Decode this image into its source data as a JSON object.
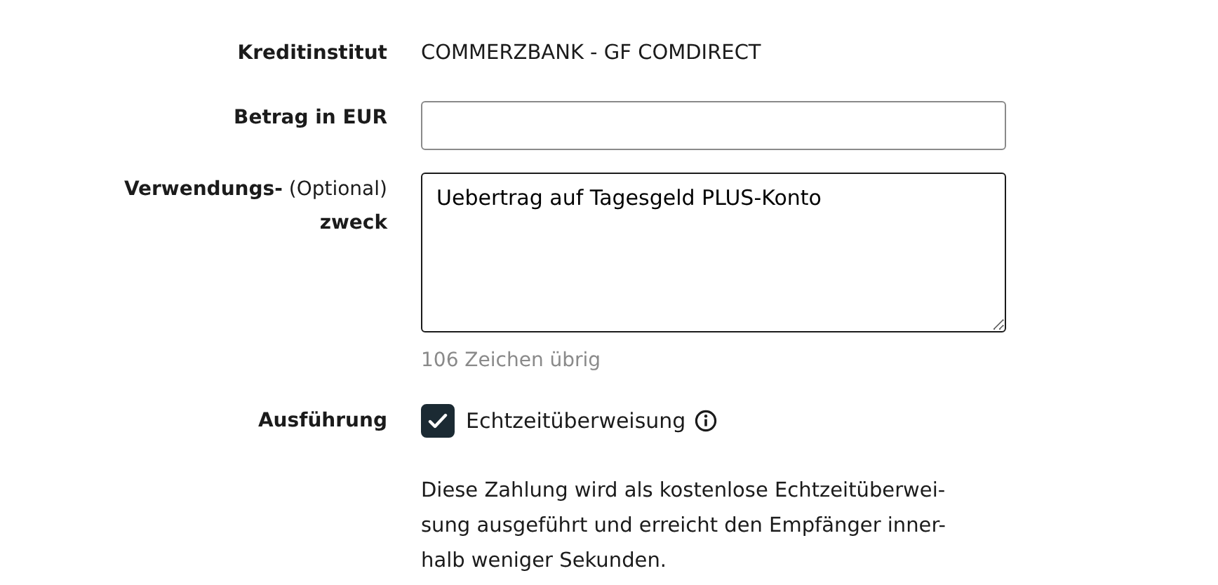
{
  "rows": [
    {
      "kind": "text",
      "label": "Kreditinstitut",
      "value": "COMMERZBANK - GF COMDIRECT"
    },
    {
      "kind": "input",
      "label": "Betrag in EUR",
      "value": ""
    },
    {
      "kind": "textarea",
      "label": "**Verwendungs-** (Optional) **zweck**",
      "value": "Uebertrag auf Tagesgeld PLUS-Konto",
      "hint": "106 Zeichen übrig"
    },
    {
      "kind": "checkbox",
      "label": "Ausführung",
      "option": "Echtzeitüberweisung",
      "checked": true,
      "description": "Diese Zahlung wird als kostenlose Echtzeitüberwei-sung ausgeführt und erreicht den Empfänger inner-halb weniger Sekunden."
    }
  ]
}
